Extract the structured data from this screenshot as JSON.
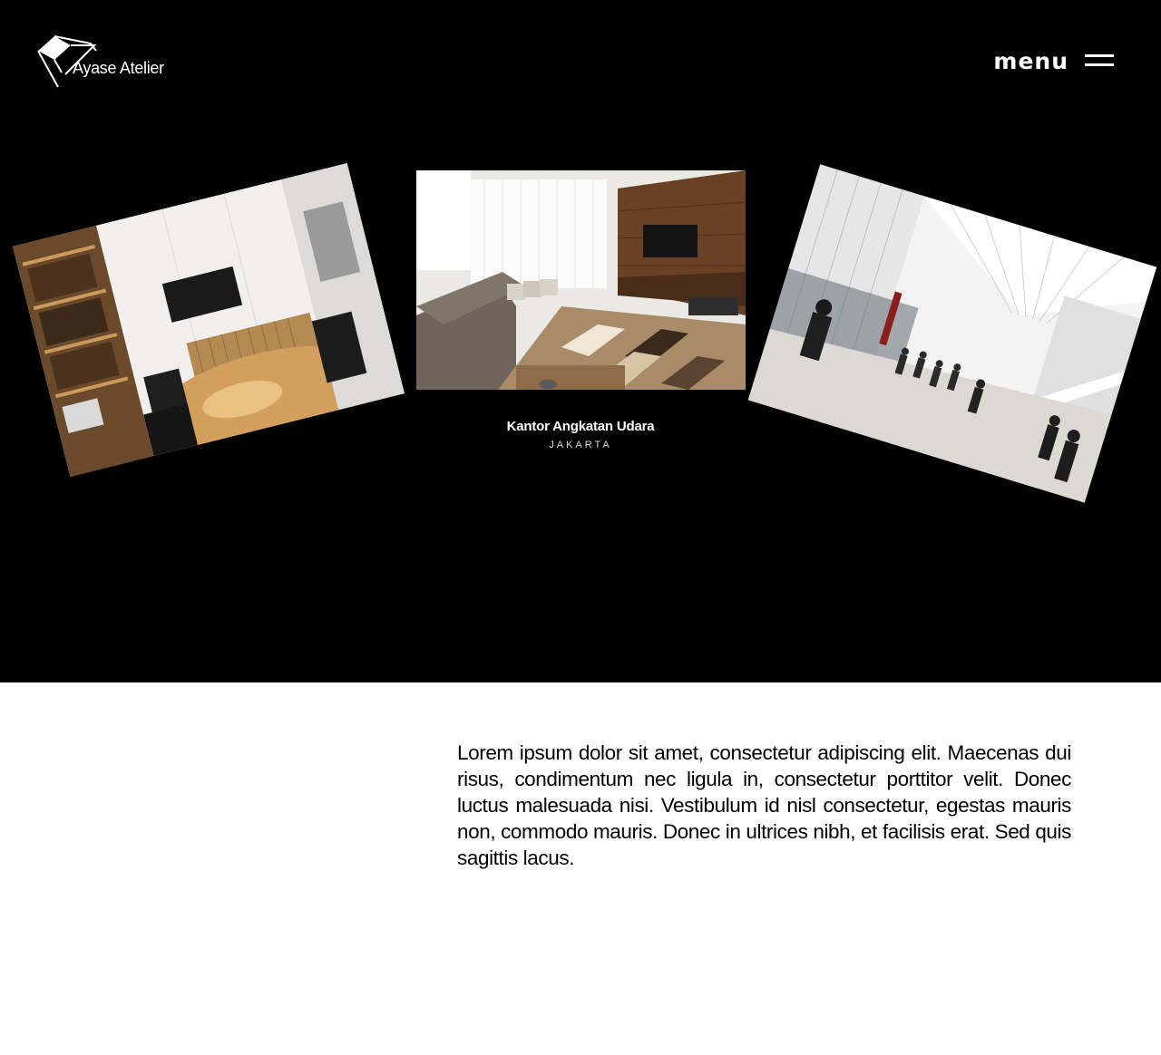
{
  "header": {
    "logo_text": "Ayase Atelier",
    "logo_icon": "folded-roof-logo-icon",
    "menu_label": "menu",
    "menu_icon": "hamburger-icon"
  },
  "gallery": {
    "slides": [
      {
        "image": "meeting-room-photo"
      },
      {
        "image": "living-room-photo",
        "title": "Kantor Angkatan Udara",
        "location": "JAKARTA"
      },
      {
        "image": "atrium-hall-photo"
      }
    ]
  },
  "content": {
    "paragraph": "Lorem ipsum dolor sit amet, consectetur adipiscing elit. Maecenas dui risus, condimentum nec ligula in, consectetur porttitor velit. Donec luctus malesuada nisi. Vestibulum id nisl consectetur, egestas mauris non, commodo mauris. Donec in ultrices nibh, et facilisis erat. Sed quis sagittis lacus."
  },
  "colors": {
    "hero_background": "#000000",
    "page_background": "#ffffff",
    "text_light": "#ffffff",
    "text_dark": "#000000"
  }
}
